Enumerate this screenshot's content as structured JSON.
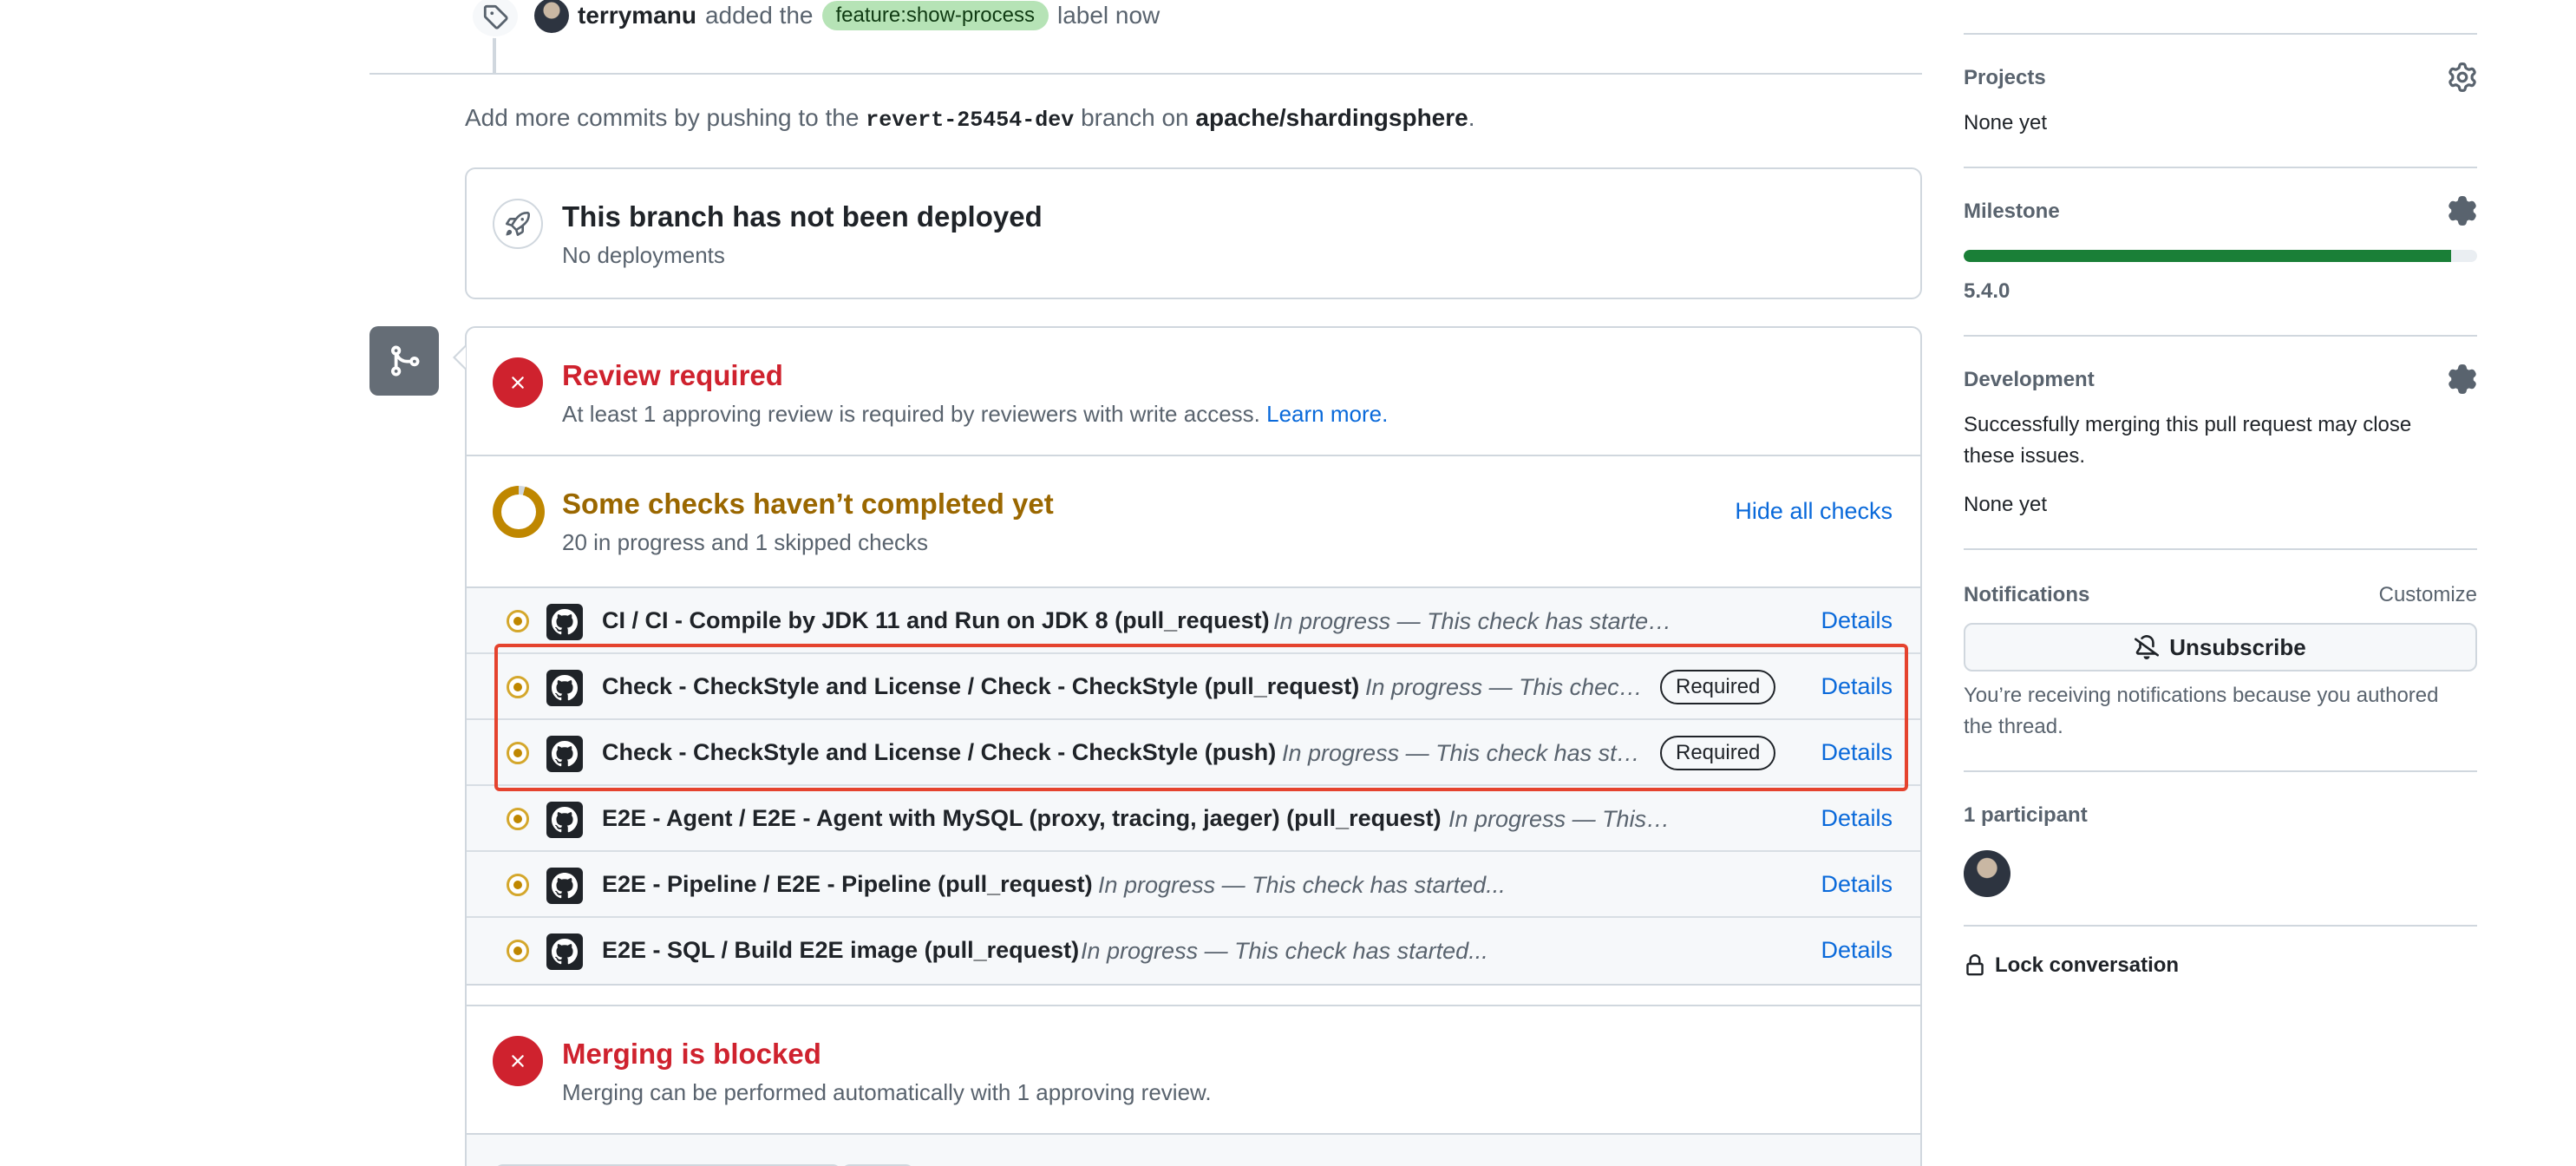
{
  "timeline_event": {
    "author": "terrymanu",
    "action": "added the",
    "label": "feature:show-process",
    "suffix": "label now"
  },
  "commit_hint": {
    "prefix": "Add more commits by pushing to the",
    "branch": "revert-25454-dev",
    "middle": "branch on",
    "repo": "apache/shardingsphere",
    "end": "."
  },
  "deployment": {
    "title": "This branch has not been deployed",
    "subtitle": "No deployments"
  },
  "review": {
    "title": "Review required",
    "subtitle": "At least 1 approving review is required by reviewers with write access.",
    "learn_more": "Learn more."
  },
  "checks": {
    "title": "Some checks haven’t completed yet",
    "subtitle": "20 in progress and 1 skipped checks",
    "hide_all": "Hide all checks",
    "details_label": "Details",
    "required_label": "Required",
    "items": [
      {
        "name": "CI / CI - Compile by JDK 11 and Run on JDK 8 (pull_request)",
        "status": "In progress — This check has starte…",
        "required": false
      },
      {
        "name": "Check - CheckStyle and License / Check - CheckStyle (pull_request)",
        "status": "In progress — This check …",
        "required": true
      },
      {
        "name": "Check - CheckStyle and License / Check - CheckStyle (push)",
        "status": "In progress — This check has star…",
        "required": true
      },
      {
        "name": "E2E - Agent / E2E - Agent with MySQL (proxy, tracing, jaeger) (pull_request)",
        "status": "In progress — This…",
        "required": false
      },
      {
        "name": "E2E - Pipeline / E2E - Pipeline (pull_request)",
        "status": "In progress — This check has started...",
        "required": false
      },
      {
        "name": "E2E - SQL / Build E2E image (pull_request)",
        "status": "In progress — This check has started...",
        "required": false
      }
    ]
  },
  "merge_blocked": {
    "title": "Merging is blocked",
    "subtitle": "Merging can be performed automatically with 1 approving review."
  },
  "sidebar": {
    "projects": {
      "heading": "Projects",
      "value": "None yet"
    },
    "milestone": {
      "heading": "Milestone",
      "value": "5.4.0",
      "progress": 0.95
    },
    "development": {
      "heading": "Development",
      "line1": "Successfully merging this pull request may close",
      "line2": "these issues.",
      "value": "None yet"
    },
    "notifications": {
      "heading": "Notifications",
      "customize": "Customize",
      "button": "Unsubscribe",
      "line1": "You’re receiving notifications because you authored",
      "line2": "the thread."
    },
    "participants": {
      "heading": "1 participant"
    },
    "lock": "Lock conversation"
  },
  "colors": {
    "danger": "#cf222e",
    "attention": "#9a6700",
    "accent": "#0969da",
    "success": "#1a7f37",
    "highlight_box": "#e5432e"
  }
}
